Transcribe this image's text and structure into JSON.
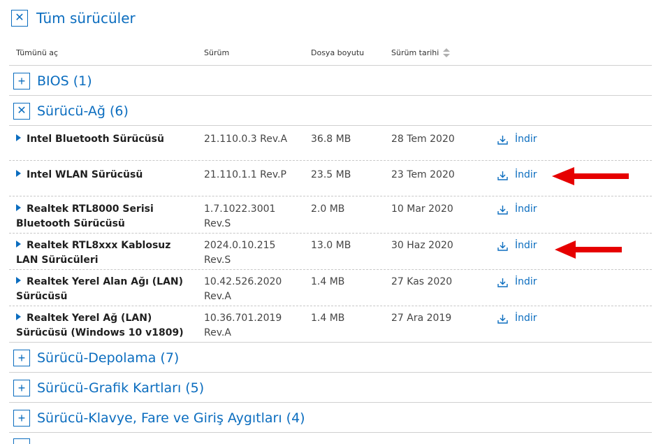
{
  "header": {
    "title": "Tüm sürücüler"
  },
  "columns": {
    "expand_all": "Tümünü aç",
    "version": "Sürüm",
    "file_size": "Dosya boyutu",
    "release_date": "Sürüm tarihi"
  },
  "categories": {
    "bios": "BIOS (1)",
    "network": "Sürücü-Ağ (6)",
    "storage": "Sürücü-Depolama (7)",
    "graphics": "Sürücü-Grafik Kartları (5)",
    "input": "Sürücü-Klavye, Fare ve Giriş Aygıtları (4)"
  },
  "drivers": [
    {
      "name": "Intel Bluetooth Sürücüsü",
      "version": "21.110.0.3 Rev.A",
      "size": "36.8 MB",
      "date": "28 Tem 2020",
      "download": "İndir"
    },
    {
      "name": "Intel WLAN Sürücüsü",
      "version": "21.110.1.1 Rev.P",
      "size": "23.5 MB",
      "date": "23 Tem 2020",
      "download": "İndir"
    },
    {
      "name": "Realtek RTL8000 Serisi Bluetooth Sürücüsü",
      "version": "1.7.1022.3001 Rev.S",
      "size": "2.0 MB",
      "date": "10 Mar 2020",
      "download": "İndir"
    },
    {
      "name": "Realtek RTL8xxx Kablosuz LAN Sürücüleri",
      "version": "2024.0.10.215 Rev.S",
      "size": "13.0 MB",
      "date": "30 Haz 2020",
      "download": "İndir"
    },
    {
      "name": "Realtek Yerel Alan Ağı (LAN) Sürücüsü",
      "version": "10.42.526.2020 Rev.A",
      "size": "1.4 MB",
      "date": "27 Kas 2020",
      "download": "İndir"
    },
    {
      "name": "Realtek Yerel Ağ (LAN) Sürücüsü (Windows 10 v1809)",
      "version": "10.36.701.2019 Rev.A",
      "size": "1.4 MB",
      "date": "27 Ara 2019",
      "download": "İndir"
    }
  ],
  "icons": {
    "collapse": "close-icon",
    "expand": "plus-icon",
    "row_toggle": "caret-right-icon",
    "download": "download-icon",
    "sort": "sort-icon",
    "annotation": "red-arrow-icon"
  },
  "colors": {
    "accent": "#0b6dbf",
    "annotation": "#e60000"
  }
}
